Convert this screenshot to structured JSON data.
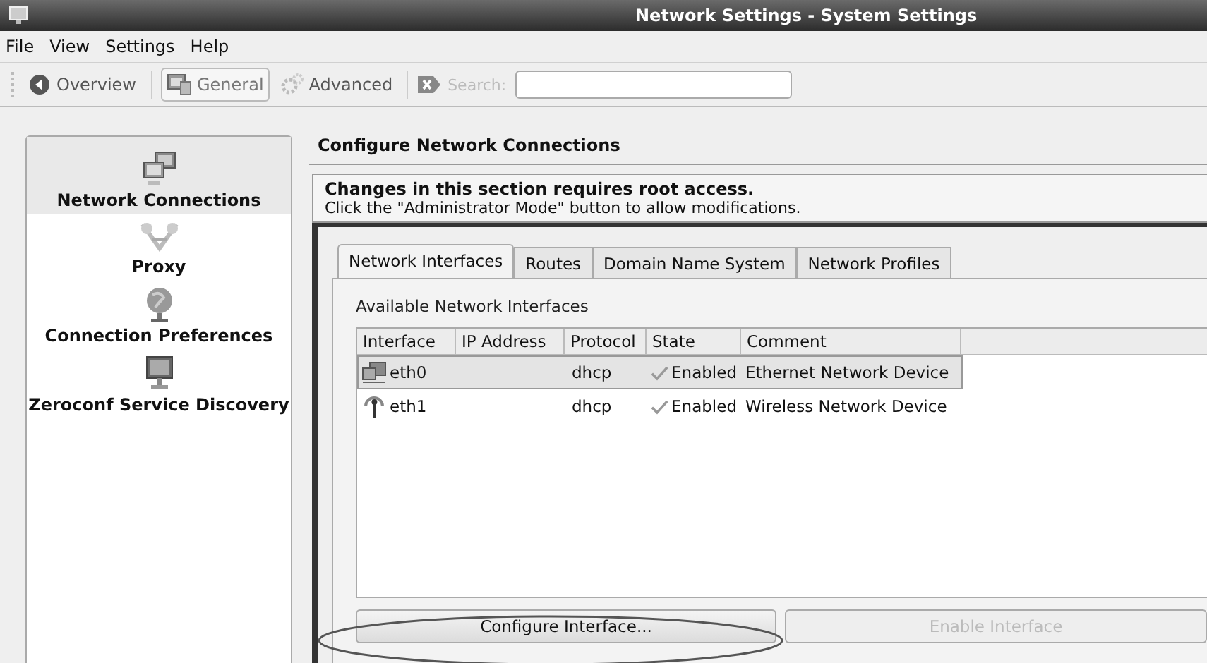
{
  "window": {
    "title": "Network Settings - System Settings"
  },
  "menu": [
    "File",
    "View",
    "Settings",
    "Help"
  ],
  "toolbar": {
    "items": [
      {
        "label": "Overview",
        "kind": "back",
        "selected": false
      },
      {
        "label": "General",
        "kind": "general",
        "selected": true
      },
      {
        "label": "Advanced",
        "kind": "advanced",
        "selected": false
      }
    ],
    "search": {
      "label": "Search:",
      "disabled": true
    }
  },
  "sidebar": {
    "items": [
      {
        "label": "Network Connections",
        "kind": "network",
        "selected": true
      },
      {
        "label": "Proxy",
        "kind": "proxy",
        "selected": false
      },
      {
        "label": "Connection Preferences",
        "kind": "globe",
        "selected": false
      },
      {
        "label": "Zeroconf Service Discovery",
        "kind": "monitor",
        "selected": false
      }
    ]
  },
  "header": "Configure Network Connections",
  "notice": {
    "title": "Changes in this section requires root access.",
    "text": "Click the \"Administrator Mode\" button to allow modifications."
  },
  "tabs": [
    {
      "label": "Network Interfaces",
      "selected": true
    },
    {
      "label": "Routes",
      "selected": false
    },
    {
      "label": "Domain Name System",
      "selected": false
    },
    {
      "label": "Network Profiles",
      "selected": false
    }
  ],
  "table": {
    "caption": "Available Network Interfaces",
    "columns": [
      "Interface",
      "IP Address",
      "Protocol",
      "State",
      "Comment"
    ],
    "rows": [
      {
        "kind": "ethernet",
        "interface": "eth0",
        "protocol": "dhcp",
        "state": "Enabled",
        "comment": "Ethernet Network Device",
        "selected": true
      },
      {
        "kind": "wireless",
        "interface": "eth1",
        "protocol": "dhcp",
        "state": "Enabled",
        "comment": "Wireless Network Device",
        "selected": false
      }
    ]
  },
  "buttons": [
    {
      "label": "Configure Interface...",
      "disabled": false,
      "highlighted": true
    },
    {
      "label": "Enable Interface",
      "disabled": true,
      "highlighted": false
    }
  ]
}
